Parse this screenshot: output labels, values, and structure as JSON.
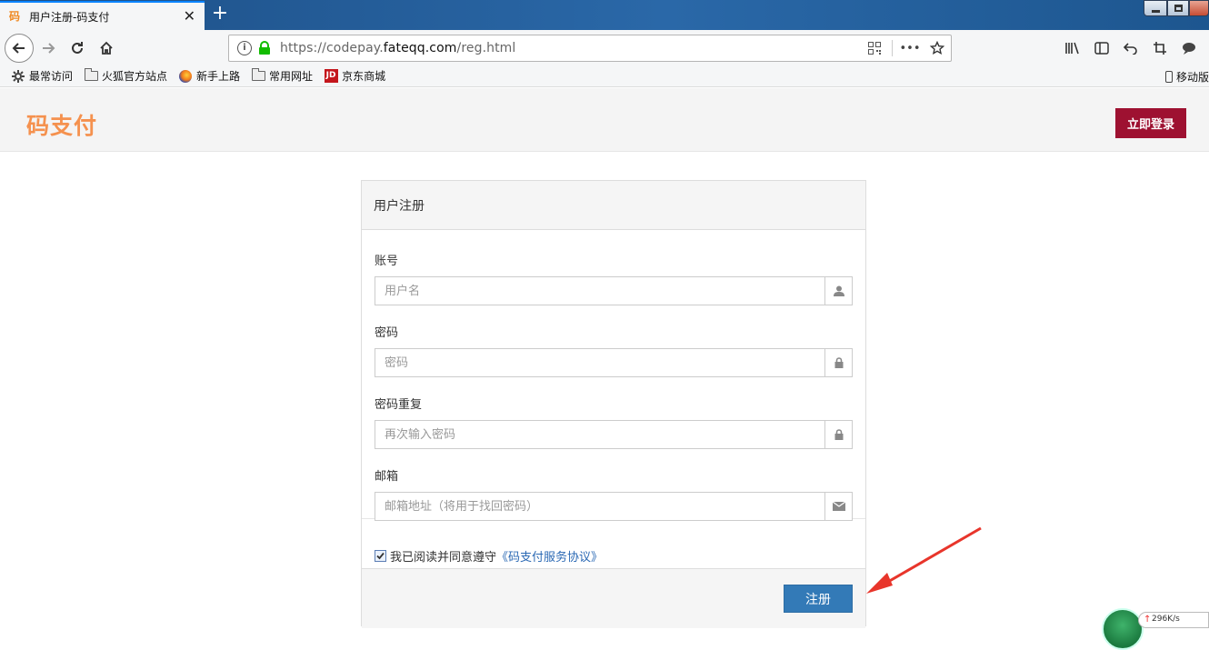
{
  "browser": {
    "tab": {
      "favicon": "码",
      "title": "用户注册-码支付"
    },
    "url": {
      "prefix": "https://codepay.",
      "host": "fateqq.com",
      "path": "/reg.html"
    },
    "bookmarks": [
      {
        "label": "最常访问",
        "icon": "gear-icon"
      },
      {
        "label": "火狐官方站点",
        "icon": "folder-icon"
      },
      {
        "label": "新手上路",
        "icon": "firefox-icon"
      },
      {
        "label": "常用网址",
        "icon": "folder-icon"
      },
      {
        "label": "京东商城",
        "icon": "jd-icon"
      }
    ],
    "jd_badge": "JD",
    "mobile_bookmarks": "移动版",
    "accent": "#0a84ff"
  },
  "site": {
    "brand": "码支付",
    "login_button": "立即登录",
    "brand_color": "#f5914e",
    "login_color": "#9e1131"
  },
  "register": {
    "title": "用户注册",
    "fields": [
      {
        "label": "账号",
        "placeholder": "用户名",
        "icon": "user-icon"
      },
      {
        "label": "密码",
        "placeholder": "密码",
        "icon": "lock-icon"
      },
      {
        "label": "密码重复",
        "placeholder": "再次输入密码",
        "icon": "lock-icon"
      },
      {
        "label": "邮箱",
        "placeholder": "邮箱地址（将用于找回密码）",
        "icon": "envelope-icon"
      }
    ],
    "agree_text": "我已阅读并同意遵守",
    "agree_link": "《码支付服务协议》",
    "agree_checked": true,
    "submit_button": "注册",
    "submit_color": "#337ab7"
  },
  "tray": {
    "speed": "296K/s"
  }
}
